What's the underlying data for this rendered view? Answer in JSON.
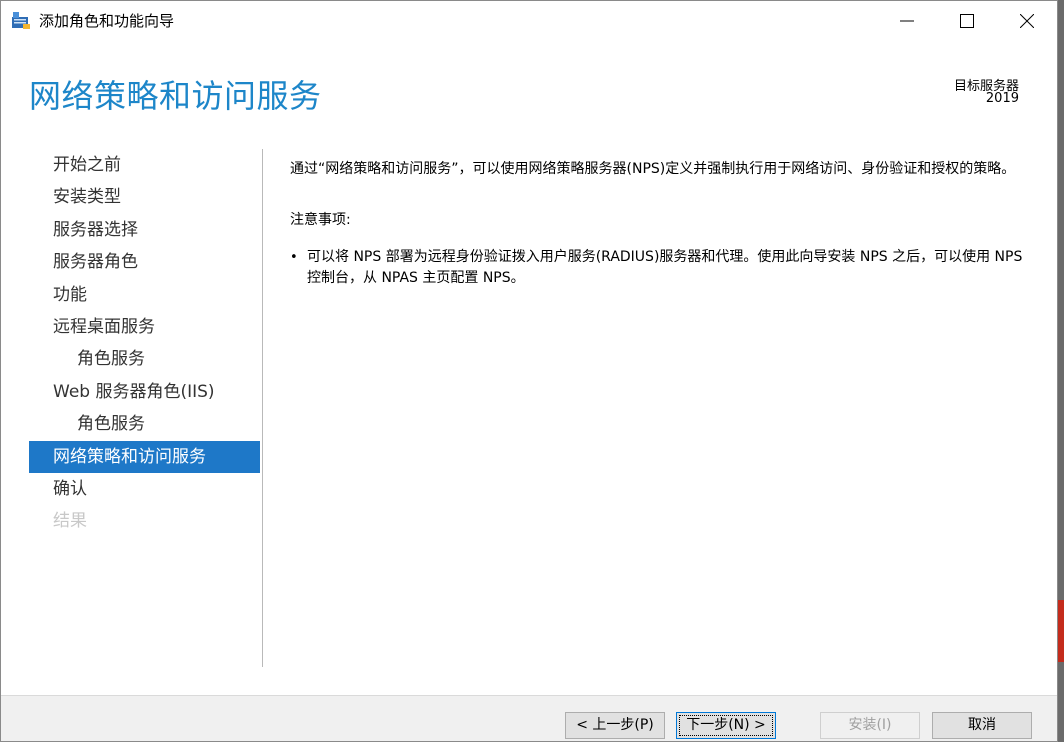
{
  "window": {
    "title": "添加角色和功能向导"
  },
  "header": {
    "title": "网络策略和访问服务",
    "target_label": "目标服务器",
    "target_value": "2019"
  },
  "nav": {
    "items": [
      {
        "label": "开始之前",
        "state": "normal"
      },
      {
        "label": "安装类型",
        "state": "normal"
      },
      {
        "label": "服务器选择",
        "state": "normal"
      },
      {
        "label": "服务器角色",
        "state": "normal"
      },
      {
        "label": "功能",
        "state": "normal"
      },
      {
        "label": "远程桌面服务",
        "state": "normal"
      },
      {
        "label": "角色服务",
        "state": "sub"
      },
      {
        "label": "Web 服务器角色(IIS)",
        "state": "normal"
      },
      {
        "label": "角色服务",
        "state": "sub"
      },
      {
        "label": "网络策略和访问服务",
        "state": "active"
      },
      {
        "label": "确认",
        "state": "normal"
      },
      {
        "label": "结果",
        "state": "disabled"
      }
    ]
  },
  "content": {
    "intro": "通过“网络策略和访问服务”，可以使用网络策略服务器(NPS)定义并强制执行用于网络访问、身份验证和授权的策略。",
    "notes_title": "注意事项:",
    "bullets": [
      "可以将 NPS 部署为远程身份验证拨入用户服务(RADIUS)服务器和代理。使用此向导安装 NPS 之后，可以使用 NPS 控制台，从 NPAS 主页配置 NPS。"
    ]
  },
  "footer": {
    "prev": "< 上一步(P)",
    "next": "下一步(N) >",
    "install": "安装(I)",
    "cancel": "取消"
  },
  "colors": {
    "accent": "#1d86c9",
    "active_nav": "#1e78c8"
  }
}
